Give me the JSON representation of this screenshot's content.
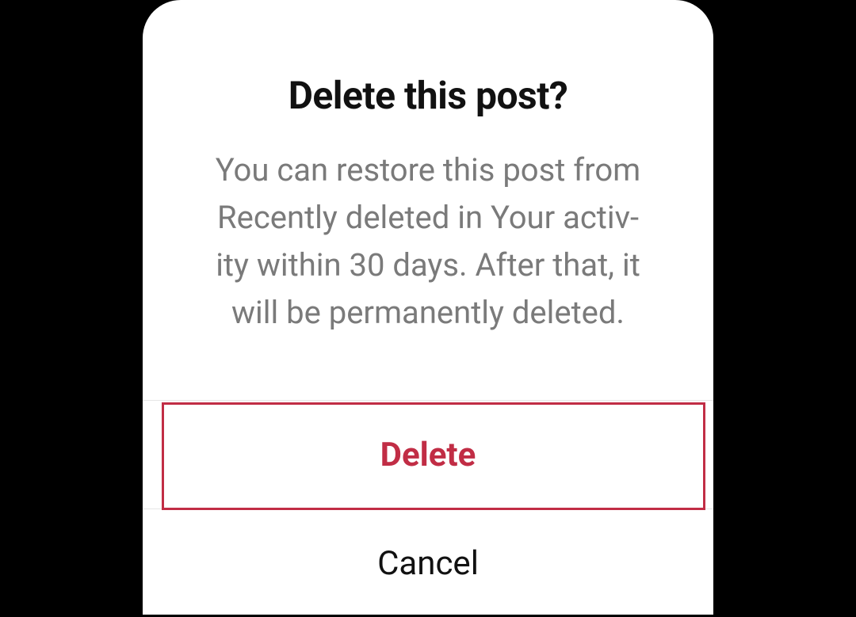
{
  "dialog": {
    "title": "Delete this post?",
    "body": "You can restore this post from Recently deleted in Your activ­ity within 30 days. After that, it will be permanently deleted.",
    "delete_label": "Delete",
    "cancel_label": "Cancel"
  },
  "colors": {
    "danger": "#c12d45",
    "body_text": "#7a7a7a",
    "title_text": "#111111",
    "divider": "#e6e6e6",
    "background": "#000000",
    "dialog_bg": "#ffffff"
  }
}
